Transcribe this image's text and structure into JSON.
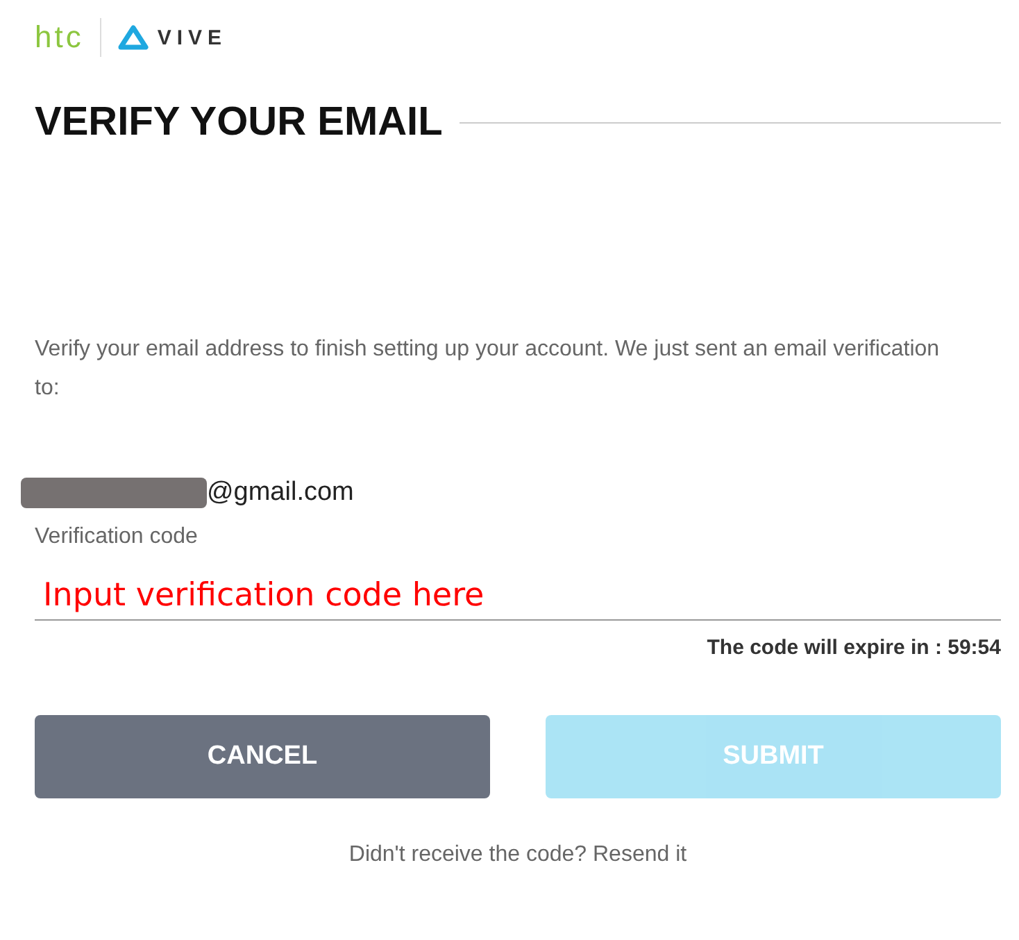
{
  "logo": {
    "brand": "htc",
    "product": "VIVE"
  },
  "title": "VERIFY YOUR EMAIL",
  "message": "Verify your email address to finish setting up your account. We just sent an email verification to:",
  "email": {
    "redacted": true,
    "domain": "@gmail.com"
  },
  "code_field": {
    "label": "Verification code",
    "value": "Input verification code here"
  },
  "expiry": "The code will expire in : 59:54",
  "buttons": [
    {
      "label": "CANCEL",
      "kind": "cancel",
      "disabled": false
    },
    {
      "label": "SUBMIT",
      "kind": "submit",
      "disabled": true
    }
  ],
  "resend": {
    "text": "Didn't receive the code?",
    "link": "Resend it"
  }
}
